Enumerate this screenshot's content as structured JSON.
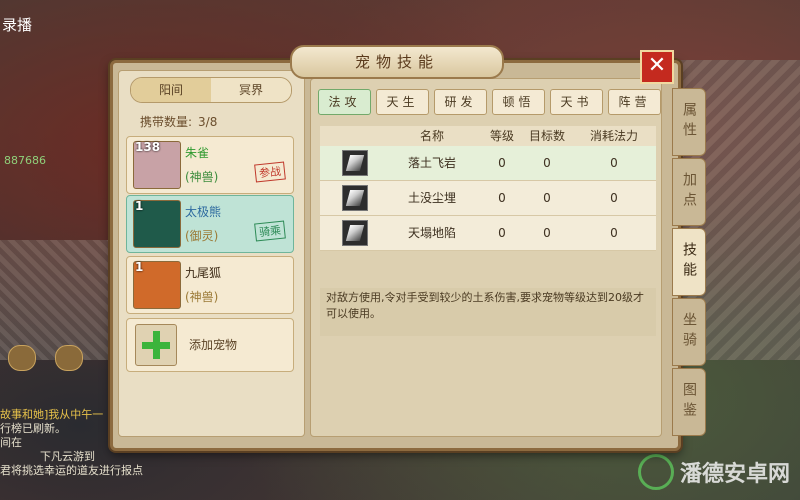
{
  "scene": {
    "top_left_text": "录播",
    "hp_text": "887686",
    "chat_lines": [
      {
        "text": "故事和她]我从中午一",
        "highlight": true
      },
      {
        "text": "行榜已刷新。",
        "highlight": false
      },
      {
        "text": "间在",
        "highlight": false
      },
      {
        "text": "下凡云游到",
        "highlight": false
      },
      {
        "text": "君将挑选幸运的道友进行报点",
        "highlight": false
      }
    ],
    "watermark": "潘德安卓网"
  },
  "dialog": {
    "title": "宠物技能",
    "close_label": "✕",
    "world_tabs": [
      "阳间",
      "冥界"
    ],
    "carry_label": "携带数量:",
    "carry_value": "3/8",
    "pets": [
      {
        "level": "138",
        "name": "朱雀",
        "type": "(神兽)",
        "stamp": "参战",
        "name_color": "#2f9a2f",
        "type_color": "#3c8c3c",
        "stamp_color": "#c0392b",
        "avatar_color": "#c8a2a6",
        "selected": false
      },
      {
        "level": "1",
        "name": "太极熊",
        "type": "(御灵)",
        "stamp": "骑乘",
        "name_color": "#2d6a9f",
        "type_color": "#9b7a36",
        "stamp_color": "#2e8b57",
        "avatar_color": "#1f5a4a",
        "selected": true
      },
      {
        "level": "1",
        "name": "九尾狐",
        "type": "(神兽)",
        "stamp": "",
        "name_color": "#3d2b16",
        "type_color": "#9b7a36",
        "stamp_color": "#000000",
        "avatar_color": "#d06a2a",
        "selected": false
      }
    ],
    "add_pet_label": "添加宠物",
    "skill_tabs": [
      "法攻",
      "天生",
      "研发",
      "顿悟",
      "天书",
      "阵营"
    ],
    "table_headers": [
      "名称",
      "等级",
      "目标数",
      "消耗法力"
    ],
    "skills": [
      {
        "name": "落土飞岩",
        "level": "0",
        "targets": "0",
        "mana": "0"
      },
      {
        "name": "土没尘埋",
        "level": "0",
        "targets": "0",
        "mana": "0"
      },
      {
        "name": "天塌地陷",
        "level": "0",
        "targets": "0",
        "mana": "0"
      }
    ],
    "description": "对敌方使用,令对手受到较少的土系伤害,要求宠物等级达到20级才可以使用。",
    "side_tabs": [
      "属性",
      "加点",
      "技能",
      "坐骑",
      "图鉴"
    ],
    "active_side_tab": "技能"
  }
}
